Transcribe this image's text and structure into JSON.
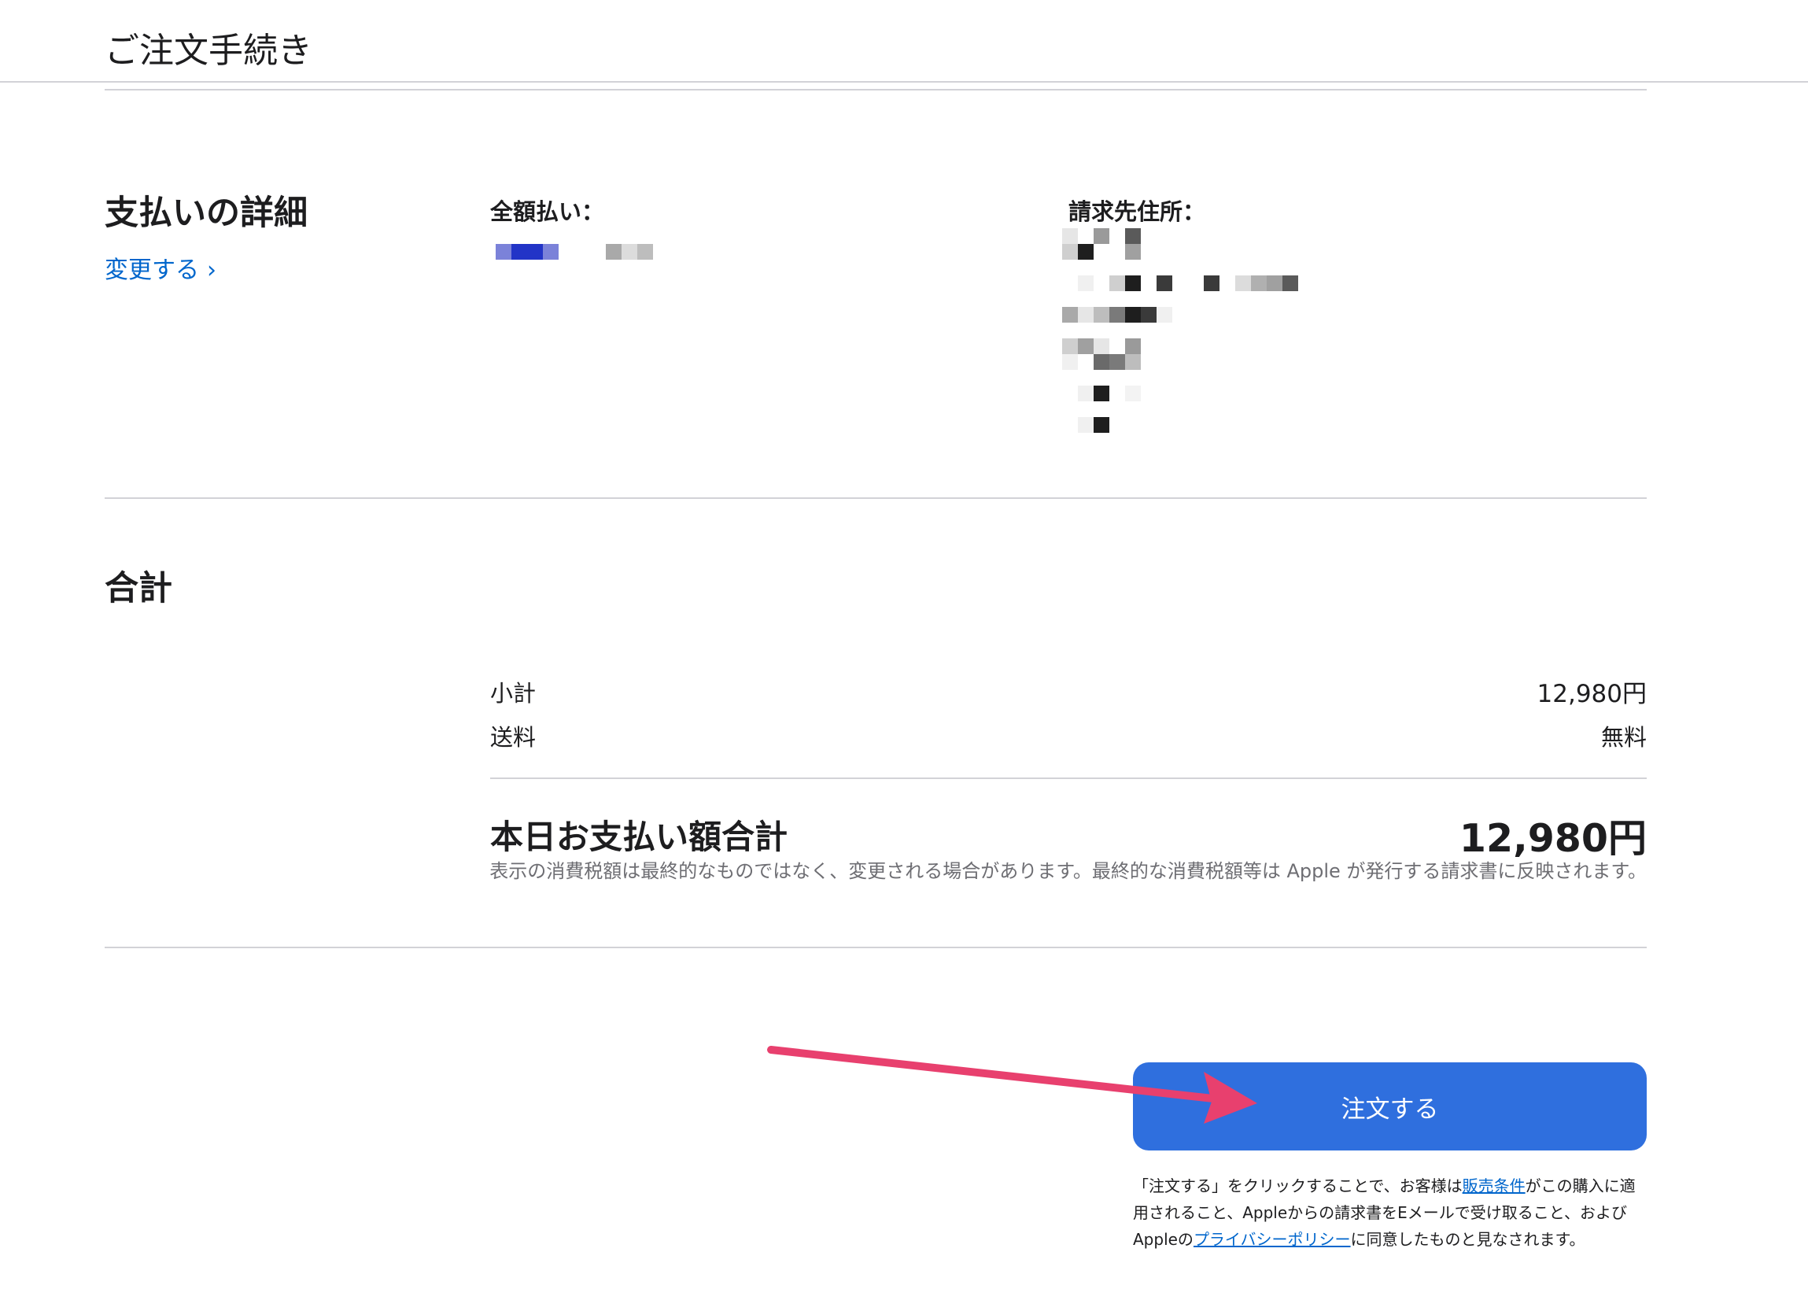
{
  "header": {
    "title": "ご注文手続き"
  },
  "payment": {
    "title": "支払いの詳細",
    "change_label": "変更する",
    "full_payment_label": "全額払い：",
    "billing_address_label": "請求先住所："
  },
  "totals": {
    "title": "合計",
    "subtotal_label": "小計",
    "subtotal_value": "12,980円",
    "shipping_label": "送料",
    "shipping_value": "無料",
    "grand_total_label": "本日お支払い額合計",
    "grand_total_value": "12,980円",
    "tax_note": "表示の消費税額は最終的なものではなく、変更される場合があります。最終的な消費税額等は Apple が発行する請求書に反映されます。"
  },
  "order": {
    "button_label": "注文する",
    "legal_part1": "「注文する」をクリックすることで、お客様は",
    "legal_link_terms": "販売条件",
    "legal_part2": "がこの購入に適用されること、Appleからの請求書をEメールで受け取ること、およびAppleの",
    "legal_link_privacy": "プライバシーポリシー",
    "legal_part3": "に同意したものと見なされます。"
  },
  "colors": {
    "accent_button": "#2f6fde",
    "link": "#0066cc",
    "annotation_arrow": "#e8406e"
  }
}
